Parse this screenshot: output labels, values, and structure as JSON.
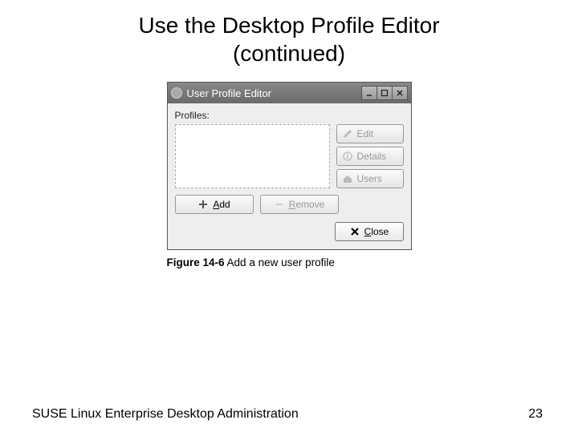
{
  "slide": {
    "title_line1": "Use the Desktop Profile Editor",
    "title_line2": "(continued)"
  },
  "window": {
    "title": "User Profile Editor",
    "profiles_label": "Profiles:",
    "buttons": {
      "edit": {
        "label": "Edit",
        "icon": "pencil-icon",
        "enabled": false
      },
      "details": {
        "label": "Details",
        "icon": "details-icon",
        "enabled": false
      },
      "users": {
        "label": "Users",
        "icon": "home-icon",
        "enabled": false
      },
      "add": {
        "label": "Add",
        "accel": "A",
        "icon": "plus-icon",
        "enabled": true
      },
      "remove": {
        "label": "Remove",
        "accel": "R",
        "icon": "minus-icon",
        "enabled": false
      },
      "close": {
        "label": "Close",
        "accel": "C",
        "icon": "x-icon",
        "enabled": true
      }
    }
  },
  "caption": {
    "figure_no": "Figure 14-6",
    "text": "Add a new user profile"
  },
  "footer": {
    "left": "SUSE Linux Enterprise Desktop Administration",
    "page": "23"
  }
}
